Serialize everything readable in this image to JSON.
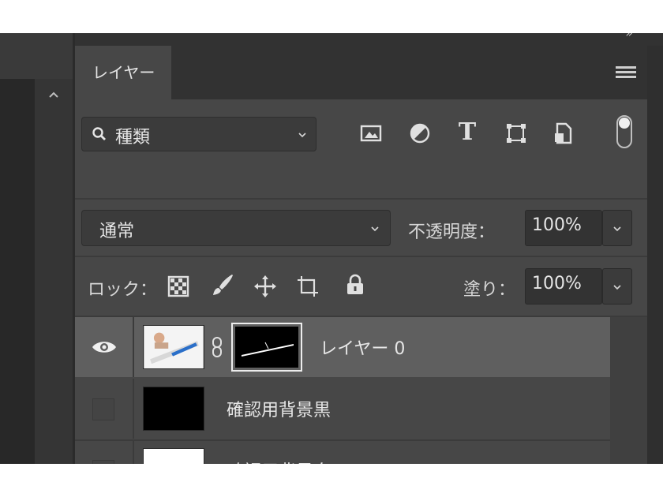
{
  "panel": {
    "tab_label": "レイヤー",
    "menu_icon": "panel-menu-icon",
    "collapse_glyph": "»"
  },
  "filter": {
    "search_icon": "search-icon",
    "kind_label": "種類",
    "filter_icons": [
      "image-filter-icon",
      "adjustment-filter-icon",
      "type-filter-icon",
      "shape-filter-icon",
      "smart-object-filter-icon"
    ],
    "type_glyph": "T",
    "toggle_on": true
  },
  "blend": {
    "mode": "通常",
    "opacity_label": "不透明度：",
    "opacity_value": "100%"
  },
  "lock": {
    "label": "ロック：",
    "icons": [
      "lock-transparent-pixels-icon",
      "lock-image-pixels-icon",
      "lock-position-icon",
      "lock-artboard-icon",
      "lock-all-icon"
    ],
    "fill_label": "塗り：",
    "fill_value": "100%"
  },
  "layers": [
    {
      "name": "レイヤー 0",
      "visible": true,
      "selected": true,
      "has_mask": true
    },
    {
      "name": "確認用背景黒",
      "visible": false,
      "selected": false,
      "thumb_color": "#000000"
    },
    {
      "name": "確認用背景白",
      "visible": false,
      "selected": false,
      "thumb_color": "#ffffff"
    }
  ],
  "colors": {
    "panel_bg": "#474747",
    "selected_row": "#5f5f5f",
    "field_bg": "#3b3b3b"
  }
}
